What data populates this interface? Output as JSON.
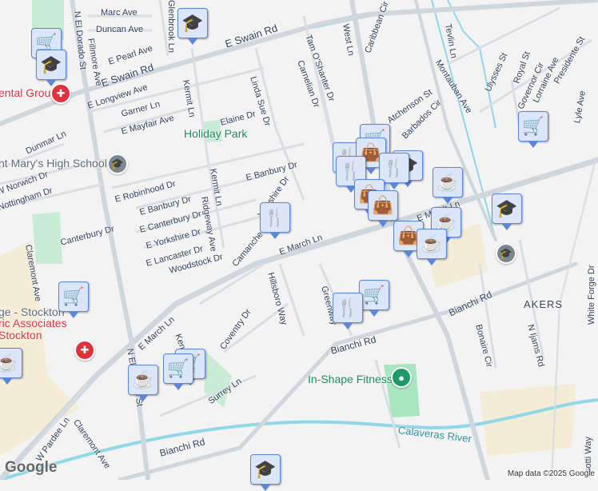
{
  "streets": {
    "marc": "Marc Ave",
    "duncan": "Duncan Ave",
    "glenbrook": "Glenbrook Ln",
    "el_dorado": "N El Dorado St",
    "fillmore": "Fillmore Ave",
    "pearl": "E Pearl Ave",
    "swain": "E Swain Rd",
    "longview": "E Longview Ave",
    "garner": "Garner Ln",
    "mayfair": "E Mayfair Ave",
    "kermit": "Kermit Ln",
    "linda_sue": "Linda Sue Dr",
    "elaine": "Elaine Dr",
    "dunmar": "Dunmar Ln",
    "norwich": "W Norwich Dr",
    "nottingham": "Nottingham Dr",
    "robinhood": "E Robinhood Dr",
    "banbury": "E Banbury Dr",
    "canterbury_e": "E Canterbury Dr",
    "yorkshire_e": "E Yorkshire Dr",
    "ridgeway": "Ridgeway Ave",
    "canterbury": "Canterbury Dr",
    "claremont": "Claremont Ave",
    "lancaster": "E Lancaster Dr",
    "woodstock": "Woodstock Dr",
    "camanche": "Camanche Ln",
    "yorkshire": "Yorkshire Dr",
    "march": "E March Ln",
    "hillsboro": "Hillsboro Way",
    "tam": "Tam O'Shanter Dr",
    "carnelian": "Carnelian Dr",
    "west": "West Ln",
    "caribbean": "Caribbean Cir",
    "tevlin": "Tevlin Ln",
    "montauban": "Montauban Ave",
    "atchenson": "Atchenson St",
    "barbados": "Barbados Cir",
    "ulysses": "Ulysses St",
    "royal": "Royal St",
    "governor": "Governor Cir",
    "lorraine": "Lorraine Ave",
    "presidente": "Presidente St",
    "lyle": "Lyle Ave",
    "kentfield": "Kentfield",
    "coventry": "Coventry Dr",
    "surrey": "Surrey Ln",
    "greenway": "Greenway",
    "bianchi": "Bianchi Rd",
    "bonaire": "Bonaire Cir",
    "ijams": "N Ijams Rd",
    "white_forge": "White Forge Dr",
    "pardee": "W Pardee Ln",
    "sotti": "sotti Way"
  },
  "places": {
    "dental": "ental Group",
    "holiday_park": "Holiday Park",
    "st_marys": "nt Mary's High School",
    "college": "ge - Stockton",
    "pediatric": "ric Associates Stockton",
    "akers": "AKERS",
    "in_shape": "In-Shape Fitness",
    "river": "Calaveras River"
  },
  "footer": {
    "logo": "Google",
    "attribution": "Map data ©2025 Google"
  },
  "colors": {
    "marker_bg": "#dbe6fb",
    "marker_border": "#5b86d9",
    "icon": "#0f4064"
  }
}
